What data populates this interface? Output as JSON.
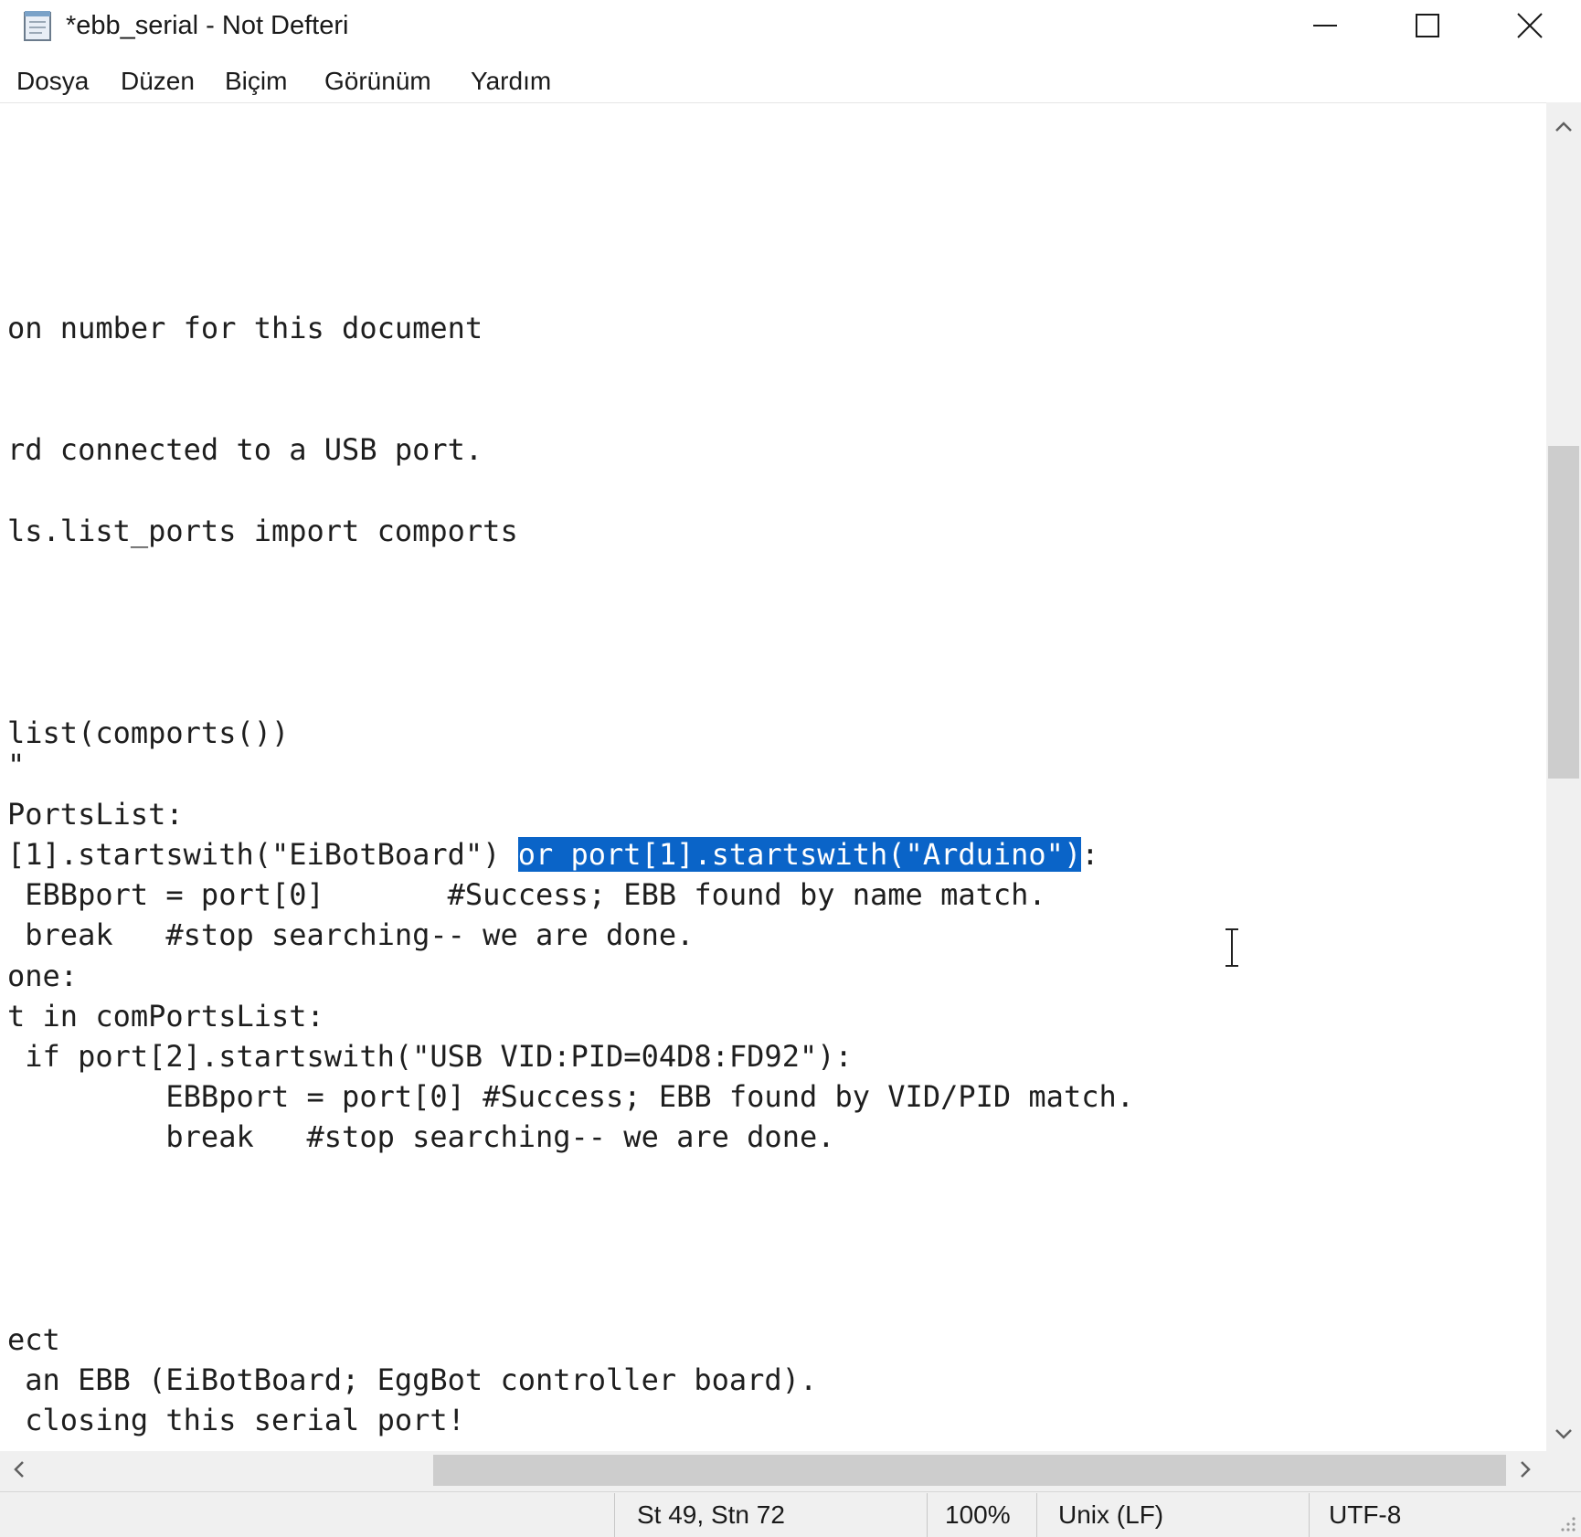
{
  "window": {
    "title": "*ebb_serial - Not Defteri",
    "icon": "notepad-icon",
    "controls": [
      "minimize-icon",
      "maximize-icon",
      "close-icon"
    ]
  },
  "menu": [
    "Dosya",
    "Düzen",
    "Biçim",
    "Görünüm",
    "Yardım"
  ],
  "editor": {
    "lines": {
      "l1": "on number for this document",
      "l2": "rd connected to a USB port.",
      "l3": "ls.list_ports import comports",
      "l4": "list(comports())",
      "l5": "\"",
      "l6": "PortsList:",
      "l7_before": "[1].startswith(\"EiBotBoard\") ",
      "l7_selected": "or port[1].startswith(\"Arduino\")",
      "l7_after": ":",
      "l8": " EBBport = port[0]       #Success; EBB found by name match.",
      "l9": " break   #stop searching-- we are done.",
      "l10": "one:",
      "l11": "t in comPortsList:",
      "l12": " if port[2].startswith(\"USB VID:PID=04D8:FD92\"):",
      "l13": "         EBBport = port[0] #Success; EBB found by VID/PID match.",
      "l14": "         break   #stop searching-- we are done.",
      "l15": "ect",
      "l16": " an EBB (EiBotBoard; EggBot controller board).",
      "l17": " closing this serial port!"
    },
    "selection_color": "#0a64c8"
  },
  "status": {
    "position": "St 49, Stn 72",
    "zoom": "100%",
    "line_ending": "Unix (LF)",
    "encoding": "UTF-8"
  }
}
